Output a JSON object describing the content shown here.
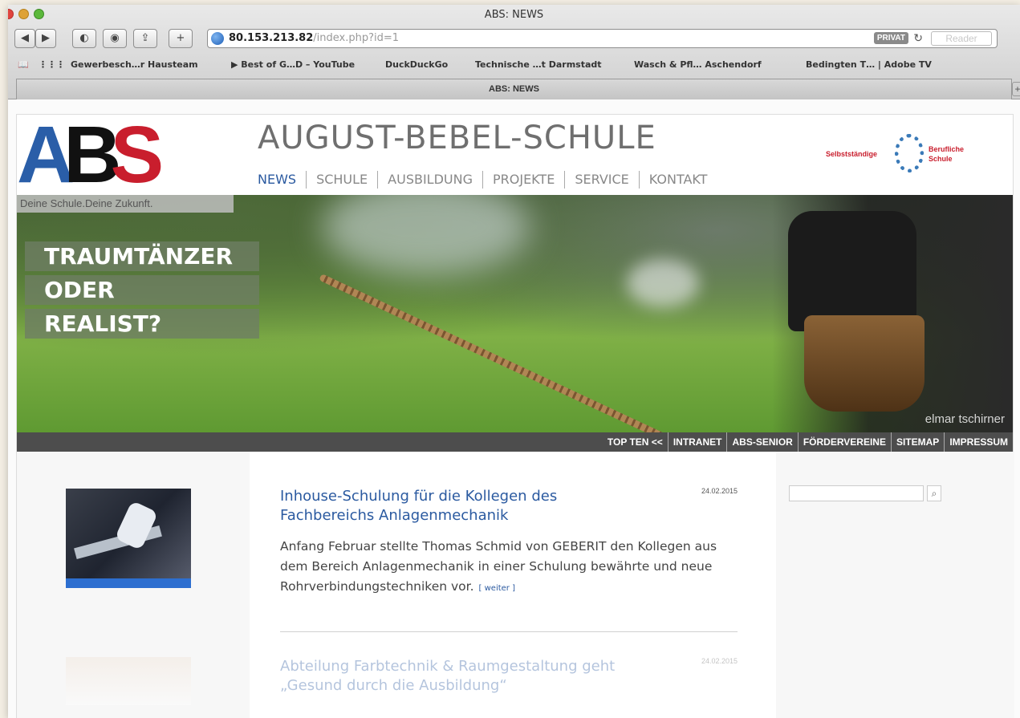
{
  "browser": {
    "window_title": "ABS: NEWS",
    "url_host": "80.153.213.82",
    "url_path": "/index.php?id=1",
    "privat_badge": "PRIVAT",
    "reader_label": "Reader",
    "tab_title": "ABS: NEWS",
    "bookmarks": [
      "Gewerbesch…r Hausteam",
      "▶ Best of G…D – YouTube",
      "DuckDuckGo",
      "Technische …t Darmstadt",
      "Wasch & Pfl… Aschendorf",
      "Bedingten T… | Adobe TV"
    ]
  },
  "site": {
    "logo_letters": [
      "A",
      "B",
      "S"
    ],
    "slogan": "Deine Schule.Deine Zukunft.",
    "school_name": "AUGUST-BEBEL-SCHULE",
    "nav": [
      "NEWS",
      "SCHULE",
      "AUSBILDUNG",
      "PROJEKTE",
      "SERVICE",
      "KONTAKT"
    ],
    "sbs_logo": {
      "left": "Selbstständige",
      "right1": "Berufliche",
      "right2": "Schule"
    },
    "hero_words": [
      "TRAUMTÄNZER",
      "ODER",
      "REALIST?"
    ],
    "photo_credit": "elmar tschirner",
    "subnav": [
      "TOP TEN <<",
      "INTRANET",
      "ABS-SENIOR",
      "FÖRDERVEREINE",
      "SITEMAP",
      "IMPRESSUM"
    ],
    "articles": [
      {
        "title": "Inhouse-Schulung für die Kollegen des Fachbereichs Anlagenmechanik",
        "date": "24.02.2015",
        "body": "Anfang Februar stellte Thomas Schmid von GEBERIT den Kollegen aus dem Bereich Anlagenmechanik in einer Schulung bewährte und neue Rohrverbindungstechniken vor.",
        "more": "[ weiter ]"
      },
      {
        "title": "Abteilung Farbtechnik & Raumgestaltung geht „Gesund durch die Ausbildung“",
        "date": "24.02.2015"
      }
    ]
  },
  "colors": {
    "accent_blue": "#2b5aa0",
    "logo_red": "#c91e2d",
    "subnav_bg": "#4d4d4d"
  }
}
